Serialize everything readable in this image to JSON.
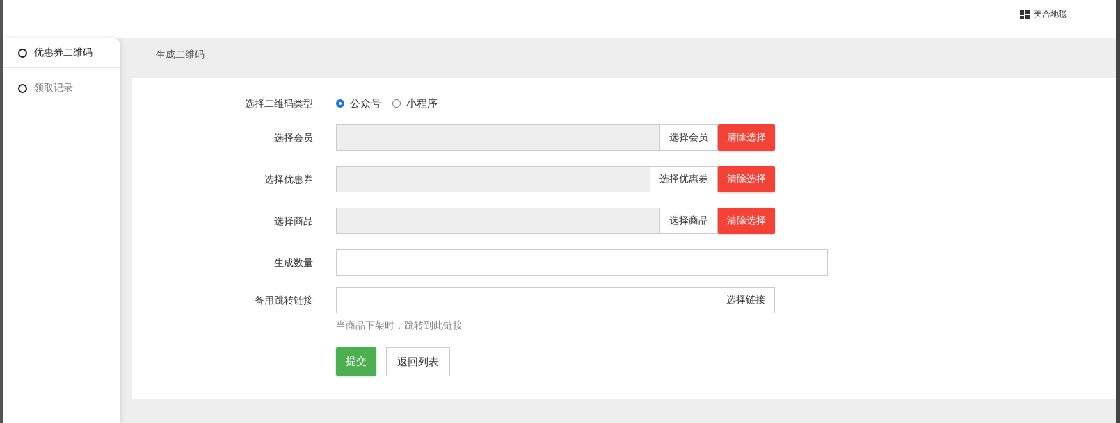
{
  "header": {
    "store_name": "美合地毯"
  },
  "sidebar": {
    "items": [
      {
        "label": "优惠券二维码",
        "selected": true
      },
      {
        "label": "领取记录",
        "selected": false
      }
    ]
  },
  "breadcrumb": "生成二维码",
  "form": {
    "rows": [
      {
        "kind": "radio",
        "label": "选择二维码类型",
        "options": [
          {
            "label": "公众号",
            "selected": true
          },
          {
            "label": "小程序",
            "selected": false
          }
        ]
      },
      {
        "kind": "picker",
        "label": "选择会员",
        "pick_button": "选择会员",
        "clear_button": "清除选择"
      },
      {
        "kind": "picker",
        "label": "选择优惠券",
        "pick_button": "选择优惠券",
        "clear_button": "清除选择"
      },
      {
        "kind": "picker",
        "label": "选择商品",
        "pick_button": "选择商品",
        "clear_button": "清除选择"
      },
      {
        "kind": "text",
        "label": "生成数量"
      },
      {
        "kind": "link",
        "label": "备用跳转链接",
        "pick_button": "选择链接",
        "help": "当商品下架时，跳转到此链接"
      }
    ],
    "submit": "提交",
    "back": "返回列表"
  }
}
